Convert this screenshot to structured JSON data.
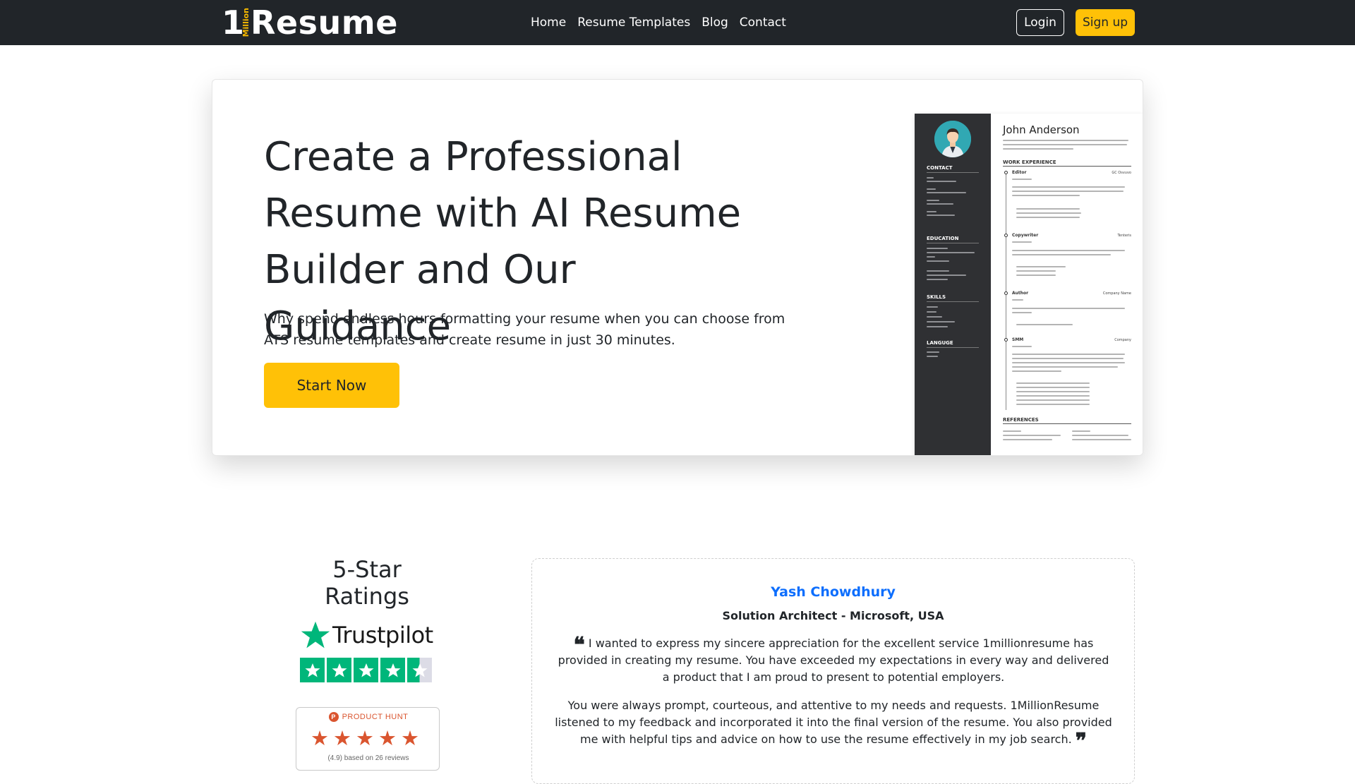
{
  "nav": {
    "logo_one": "1",
    "logo_million": "Million",
    "logo_word": "Resume",
    "links": [
      "Home",
      "Resume Templates",
      "Blog",
      "Contact"
    ],
    "login": "Login",
    "signup": "Sign up"
  },
  "hero": {
    "title": "Create a Professional Resume with AI Resume Builder and Our Guidance",
    "subtitle": "Why spend endless hours formatting your resume when you can choose from ATS resume templates and create resume in just 30 minutes.",
    "cta": "Start Now"
  },
  "resume_preview": {
    "name": "John Anderson",
    "sections_left": [
      "CONTACT",
      "EDUCATION",
      "SKILLS",
      "LANGUGE"
    ],
    "sections_right": [
      "WORK EXPERIENCE",
      "REFERENCES"
    ],
    "jobs": [
      {
        "title": "Editor",
        "company": "GC Osvuvo"
      },
      {
        "title": "Copywriter",
        "company": "Tenteris"
      },
      {
        "title": "Author",
        "company": "Company Name"
      },
      {
        "title": "SMM",
        "company": "Company"
      }
    ]
  },
  "ratings": {
    "title": "5-Star Ratings",
    "trustpilot": "Trustpilot",
    "trustpilot_stars": 4.5,
    "producthunt_label": "PRODUCT HUNT",
    "producthunt_logo": "P",
    "producthunt_stars": 5,
    "producthunt_note": "(4.9) based on 26 reviews"
  },
  "testimonial": {
    "name": "Yash Chowdhury",
    "role": "Solution Architect - Microsoft, USA",
    "open_quote": "❝",
    "close_quote": "❞",
    "para1": "I wanted to express my sincere appreciation for the excellent service 1millionresume has provided in creating my resume. You have exceeded my expectations in every way and delivered a product that I am proud to present to potential employers.",
    "para2": "You were always prompt, courteous, and attentive to my needs and requests. 1MillionResume listened to my feedback and incorporated it into the final version of the resume. You also provided me with helpful tips and advice on how to use the resume effectively in my job search."
  },
  "colors": {
    "navbar": "#212529",
    "accent": "#ffc107",
    "trustpilot_green": "#00b67a",
    "producthunt_orange": "#da552f",
    "link_blue": "#0d6efd"
  }
}
